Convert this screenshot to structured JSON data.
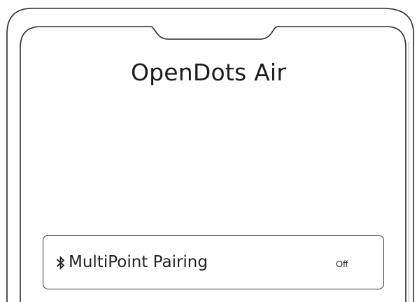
{
  "app": {
    "title": "OpenDots Air"
  },
  "settings": [
    {
      "icon": "bluetooth-icon",
      "label": "MultiPoint Pairing",
      "status": "Off"
    }
  ],
  "colors": {
    "outline": "#2b2b2b",
    "text": "#1c1c1c",
    "background": "#ffffff"
  }
}
